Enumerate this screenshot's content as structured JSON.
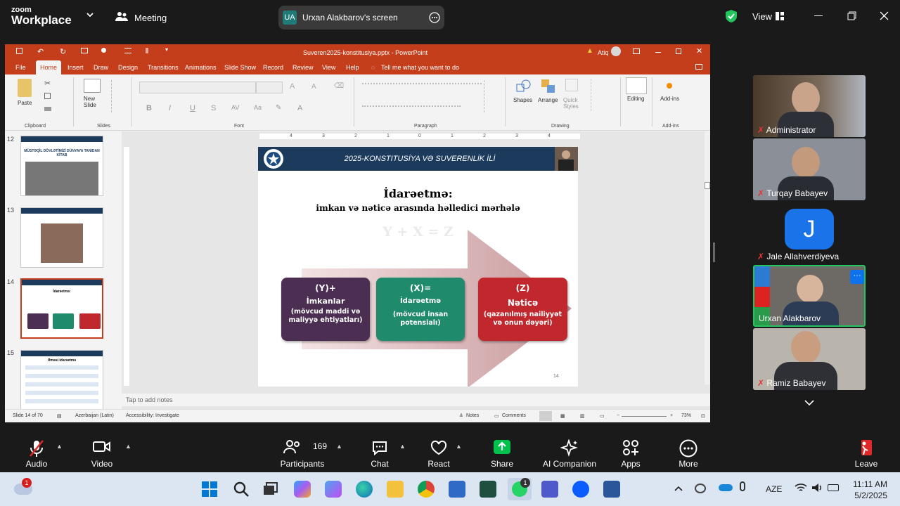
{
  "zoom": {
    "logo_top": "zoom",
    "logo_bottom": "Workplace",
    "meeting_label": "Meeting",
    "screen_initials": "UA",
    "screen_label": "Urxan Alakbarov's screen",
    "view_label": "View"
  },
  "ppt": {
    "filename": "Suveren2025-konstitusiya.pptx - PowerPoint",
    "user_initials": "Atiq",
    "menu": [
      "File",
      "Home",
      "Insert",
      "Draw",
      "Design",
      "Transitions",
      "Animations",
      "Slide Show",
      "Record",
      "Review",
      "View",
      "Help"
    ],
    "tell_me": "Tell me what you want to do",
    "ribbon": {
      "paste": "Paste",
      "new_slide": "New Slide",
      "group_clipboard": "Clipboard",
      "group_slides": "Slides",
      "group_font": "Font",
      "group_paragraph": "Paragraph",
      "group_drawing": "Drawing",
      "group_addins": "Add-ins",
      "shapes": "Shapes",
      "arrange": "Arrange",
      "quick_styles": "Quick Styles",
      "editing": "Editing",
      "addins": "Add-ins"
    },
    "thumbs": [
      {
        "num": "12",
        "title": "MÜSTƏQİL DÖVLƏTİMİZİ DÜNYAYA TANIDAN KİTAB"
      },
      {
        "num": "13"
      },
      {
        "num": "14",
        "title": "İdarəetmə:"
      },
      {
        "num": "15",
        "title": "Əməsi idarəetmə"
      }
    ],
    "ruler_numbers": [
      "4",
      "3",
      "2",
      "1",
      "0",
      "1",
      "2",
      "3",
      "4"
    ],
    "notes_placeholder": "Tap to add notes",
    "status": {
      "slide": "Slide 14 of 70",
      "language": "Azerbaijan (Latin)",
      "accessibility": "Accessibility: Investigate",
      "notes": "Notes",
      "comments": "Comments",
      "zoom": "73%"
    }
  },
  "slide": {
    "banner": "2025-KONSTITUSİYA VƏ SUVERENLİK İLİ",
    "title": "İdarəetmə:",
    "subtitle": "imkan və nəticə arasında həlledici mərhələ",
    "formula": "Y + X = Z",
    "box1": {
      "head": "(Y)+",
      "name": "İmkanlar",
      "desc": "(mövcud maddi və maliyyə ehtiyatları)"
    },
    "box2": {
      "head": "(X)=",
      "name": "İdarəetmə",
      "desc": "(mövcud insan potensialı)"
    },
    "box3": {
      "head": "(Z)",
      "name": "Nəticə",
      "desc": "(qazanılmış nailiyyət və onun dəyəri)"
    },
    "page_number": "14"
  },
  "participants": [
    {
      "name": "Administrator"
    },
    {
      "name": "Turqay Babayev"
    },
    {
      "name": "Jale Allahverdiyeva",
      "initial": "J"
    },
    {
      "name": "Urxan Alakbarov"
    },
    {
      "name": "Ramiz Babayev"
    }
  ],
  "controls": {
    "audio": "Audio",
    "video": "Video",
    "participants": "Participants",
    "participants_count": "169",
    "chat": "Chat",
    "react": "React",
    "share": "Share",
    "ai": "AI Companion",
    "apps": "Apps",
    "more": "More",
    "leave": "Leave"
  },
  "taskbar": {
    "lang": "AZE",
    "time": "11:11 AM",
    "date": "5/2/2025",
    "badge": "1",
    "whatsapp_badge": "1"
  },
  "colors": {
    "ppt_red": "#c43e1c",
    "zoom_green": "#00a88a",
    "box1": "#4b2e52",
    "box2": "#1f8a6c",
    "box3": "#c0282d",
    "banner": "#1b3a5c"
  }
}
